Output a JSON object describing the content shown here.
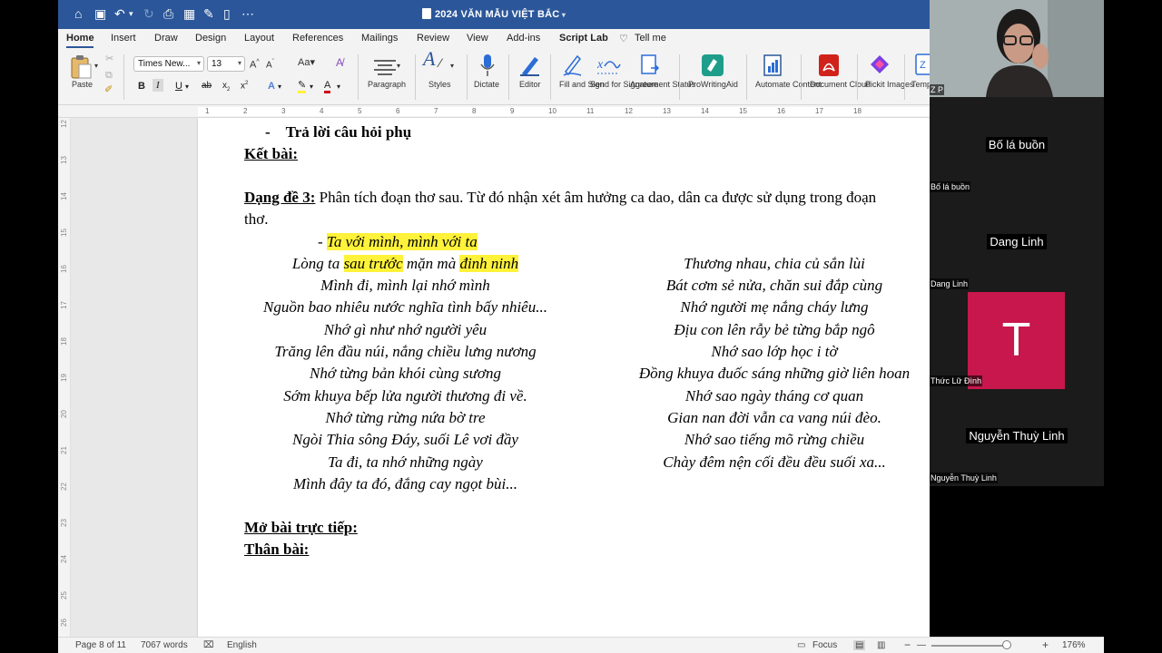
{
  "window": {
    "title": "2024 VĂN MẪU VIỆT BẮC"
  },
  "tabs": [
    "Home",
    "Insert",
    "Draw",
    "Design",
    "Layout",
    "References",
    "Mailings",
    "Review",
    "View",
    "Add-ins",
    "Script Lab",
    "Tell me"
  ],
  "ribbon": {
    "paste": "Paste",
    "font_name": "Times New...",
    "font_size": "13",
    "paragraph": "Paragraph",
    "styles": "Styles",
    "dictate": "Dictate",
    "editor": "Editor",
    "fill_sign": "Fill and Sign",
    "send_signature": "Send for Signature",
    "agreement_status": "Agreement Status",
    "prowritingaid": "ProWritingAid",
    "automate_content": "Automate Content",
    "document_cloud": "Document Cloud",
    "pickit_images": "Pickit Images",
    "templates": "Temp Choo"
  },
  "ruler": [
    "1",
    "2",
    "3",
    "4",
    "5",
    "6",
    "7",
    "8",
    "9",
    "10",
    "11",
    "12",
    "13",
    "14",
    "15",
    "16",
    "17",
    "18"
  ],
  "document": {
    "bullet_reply": "Trả lời câu hỏi phụ",
    "ket_bai": "Kết bài:",
    "dang_de_label": "Dạng đề 3:",
    "dang_de_text": " Phân tích đoạn thơ sau. Từ đó nhận xét âm hưởng ca dao, dân ca được sử dụng trong đoạn",
    "dang_de_cont": "thơ.",
    "poem_left": [
      "- Ta với mình, mình với ta",
      "Lòng ta sau trước mặn mà đinh ninh",
      "Mình đi, mình lại nhớ mình",
      "Nguồn bao nhiêu nước nghĩa tình bấy nhiêu...",
      "Nhớ gì như nhớ người yêu",
      "Trăng lên đầu núi, nắng chiều lưng nương",
      "Nhớ từng bản khói cùng sương",
      "Sớm khuya bếp lửa người thương đi về.",
      "Nhớ từng rừng nứa bờ tre",
      "Ngòi Thia sông Đáy, suối Lê vơi đầy",
      "Ta đi, ta nhớ những ngày",
      "Mình đây ta đó, đắng cay ngọt bùi..."
    ],
    "poem_left_line1_prefix": "- ",
    "poem_left_line1_hl": "Ta với mình, mình với ta",
    "poem_left_line2_a": "Lòng ta ",
    "poem_left_line2_hl1": "sau trước",
    "poem_left_line2_b": " mặn mà ",
    "poem_left_line2_hl2": "đinh ninh",
    "poem_right": [
      "Thương nhau, chia củ sắn lùi",
      "Bát cơm sẻ nửa, chăn sui đắp cùng",
      "Nhớ người mẹ nắng cháy lưng",
      "Địu con lên rẫy bẻ từng bắp ngô",
      "Nhớ sao lớp học i tờ",
      "Đồng khuya đuốc sáng những giờ liên hoan",
      "Nhớ sao ngày tháng cơ quan",
      "Gian nan đời vẫn ca vang núi đèo.",
      "Nhớ sao tiếng mõ rừng chiều",
      "Chày đêm nện cối đều đều suối xa..."
    ],
    "mo_bai": "Mở bài trực tiếp:",
    "than_bai": "Thân bài:"
  },
  "statusbar": {
    "page": "Page 8 of 11",
    "words": "7067 words",
    "language": "English",
    "focus": "Focus",
    "zoom": "176%"
  },
  "vruler": [
    "12",
    "13",
    "14",
    "15",
    "16",
    "17",
    "18",
    "19",
    "20",
    "21",
    "22",
    "23",
    "24",
    "25",
    "26"
  ],
  "zoom": {
    "self_label": "Z P",
    "participants": [
      {
        "big": "Bố lá buồn",
        "small": "Bố lá buồn"
      },
      {
        "big": "Dang Linh",
        "small": "Dang Linh"
      },
      {
        "big": "",
        "small": "Thức Lữ Đình",
        "initial": "T"
      },
      {
        "big": "Nguyễn Thuỳ Linh",
        "small": "Nguyễn Thuỳ Linh"
      }
    ]
  },
  "colors": {
    "title_bar": "#2b579a",
    "highlight": "#fff23a",
    "avatar_bg": "#c8174d"
  }
}
